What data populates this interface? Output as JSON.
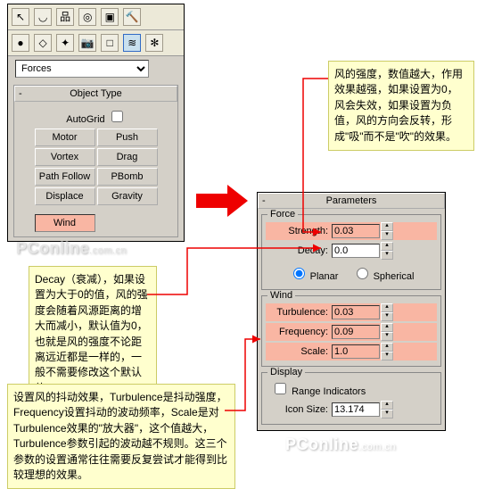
{
  "left_panel": {
    "dropdown": "Forces",
    "object_type_header": "Object Type",
    "autogrid_label": "AutoGrid",
    "buttons": [
      [
        "Motor",
        "Push"
      ],
      [
        "Vortex",
        "Drag"
      ],
      [
        "Path Follow",
        "PBomb"
      ],
      [
        "Displace",
        "Gravity"
      ],
      [
        "Wind",
        ""
      ]
    ]
  },
  "right_panel": {
    "header": "Parameters",
    "force": {
      "title": "Force",
      "strength_label": "Strength:",
      "strength_value": "0.03",
      "decay_label": "Decay:",
      "decay_value": "0.0",
      "planar": "Planar",
      "spherical": "Spherical"
    },
    "wind": {
      "title": "Wind",
      "turbulence_label": "Turbulence:",
      "turbulence_value": "0.03",
      "frequency_label": "Frequency:",
      "frequency_value": "0.09",
      "scale_label": "Scale:",
      "scale_value": "1.0"
    },
    "display": {
      "title": "Display",
      "range_label": "Range Indicators",
      "icon_size_label": "Icon Size:",
      "icon_size_value": "13.174"
    }
  },
  "notes": {
    "strength": "风的强度，数值越大，作用效果越强，如果设置为0，风会失效，如果设置为负值，风的方向会反转，形成\"吸\"而不是\"吹\"的效果。",
    "decay": "Decay（衰减），如果设置为大于0的值，风的强度会随着风源距离的增大而减小，默认值为0，也就是风的强度不论距离远近都是一样的，一般不需要修改这个默认值。",
    "wind": "设置风的抖动效果，Turbulence是抖动强度，Frequency设置抖动的波动频率，Scale是对Turbulence效果的\"放大器\"，这个值越大，Turbulence参数引起的波动越不规则。这三个参数的设置通常往往需要反复尝试才能得到比较理想的效果。"
  },
  "watermark": {
    "main": "PConline",
    "sub": ".com.cn"
  }
}
